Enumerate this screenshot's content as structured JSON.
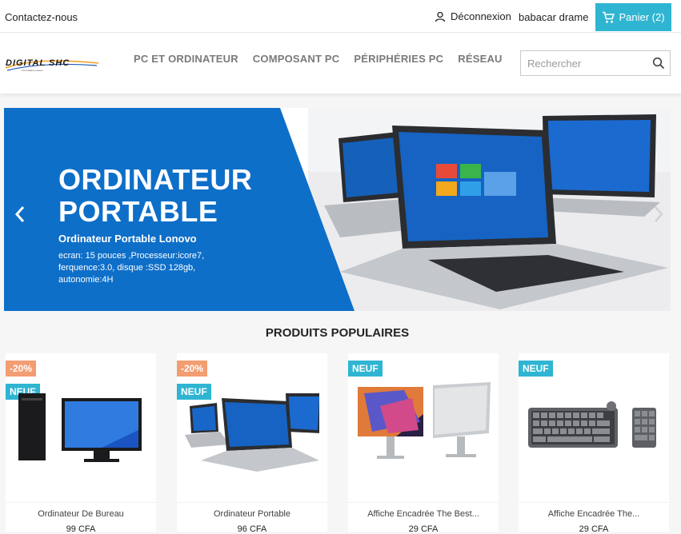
{
  "topbar": {
    "contact": "Contactez-nous",
    "logout": "Déconnexion",
    "user": "babacar drame",
    "cart": "Panier (2)"
  },
  "header": {
    "logo_alt": "DIGITAL SHC",
    "nav": [
      "PC ET ORDINATEUR",
      "COMPOSANT PC",
      "PÉRIPHÉRIES PC",
      "RÉSEAU"
    ],
    "search_placeholder": "Rechercher"
  },
  "slider": {
    "title_line1": "ORDINATEUR",
    "title_line2": "PORTABLE",
    "subtitle": "Ordinateur Portable Lonovo",
    "description": "ecran: 15 pouces ,Processeur:icore7, ferquence:3.0, disque :SSD 128gb, autonomie:4H"
  },
  "section_title": "PRODUITS POPULAIRES",
  "products": [
    {
      "discount": "-20%",
      "new": "NEUF",
      "name": "Ordinateur De Bureau",
      "price": "99 CFA"
    },
    {
      "discount": "-20%",
      "new": "NEUF",
      "name": "Ordinateur Portable",
      "price": "96 CFA"
    },
    {
      "discount": "",
      "new": "NEUF",
      "name": "Affiche Encadrée The Best...",
      "price": "29 CFA"
    },
    {
      "discount": "",
      "new": "NEUF",
      "name": "Affiche Encadrée The...",
      "price": "29 CFA"
    }
  ],
  "colors": {
    "accent": "#2fb5d2",
    "discount": "#f39d72",
    "slide_blue": "#0e6fc9"
  }
}
